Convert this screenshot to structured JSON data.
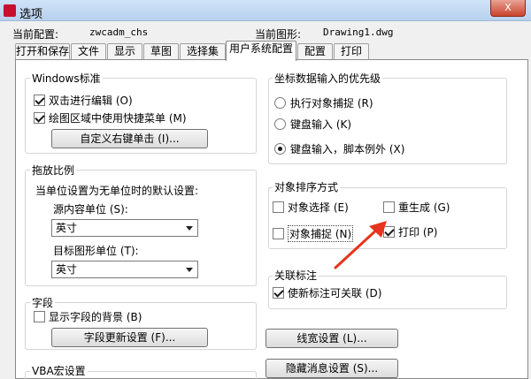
{
  "window": {
    "title": "选项",
    "close_label": "X"
  },
  "info": {
    "current_config_label": "当前配置:",
    "current_config_value": "zwcadm_chs",
    "current_drawing_label": "当前图形:",
    "current_drawing_value": "Drawing1.dwg"
  },
  "tabs": [
    {
      "label": "打开和保存"
    },
    {
      "label": "文件"
    },
    {
      "label": "显示"
    },
    {
      "label": "草图"
    },
    {
      "label": "选择集"
    },
    {
      "label": "用户系统配置"
    },
    {
      "label": "配置"
    },
    {
      "label": "打印"
    }
  ],
  "windows_std": {
    "title": "Windows标准",
    "double_click_edit": "双击进行编辑 (O)",
    "shortcut_menu": "绘图区域中使用快捷菜单 (M)",
    "custom_right_click": "自定义右键单击 (I)..."
  },
  "drag_scale": {
    "title": "拖放比例",
    "desc": "当单位设置为无单位时的默认设置:",
    "source_label": "源内容单位 (S):",
    "source_value": "英寸",
    "target_label": "目标图形单位 (T):",
    "target_value": "英寸"
  },
  "fields": {
    "title": "字段",
    "show_bg": "显示字段的背景 (B)",
    "update_settings": "字段更新设置 (F)..."
  },
  "vba": {
    "title": "VBA宏设置"
  },
  "coord_priority": {
    "title": "坐标数据输入的优先级",
    "opt1": "执行对象捕捉 (R)",
    "opt2": "键盘输入 (K)",
    "opt3": "键盘输入，脚本例外 (X)"
  },
  "object_sort": {
    "title": "对象排序方式",
    "select": "对象选择 (E)",
    "regen": "重生成 (G)",
    "snap": "对象捕捉 (N)",
    "print": "打印 (P)"
  },
  "assoc_dim": {
    "title": "关联标注",
    "new_assoc": "使新标注可关联 (D)"
  },
  "buttons": {
    "lineweight": "线宽设置 (L)...",
    "hidden_msg": "隐藏消息设置 (S)..."
  },
  "colors": {
    "annotation_arrow": "#e8341c",
    "title_bar": "#b9d1ee"
  }
}
